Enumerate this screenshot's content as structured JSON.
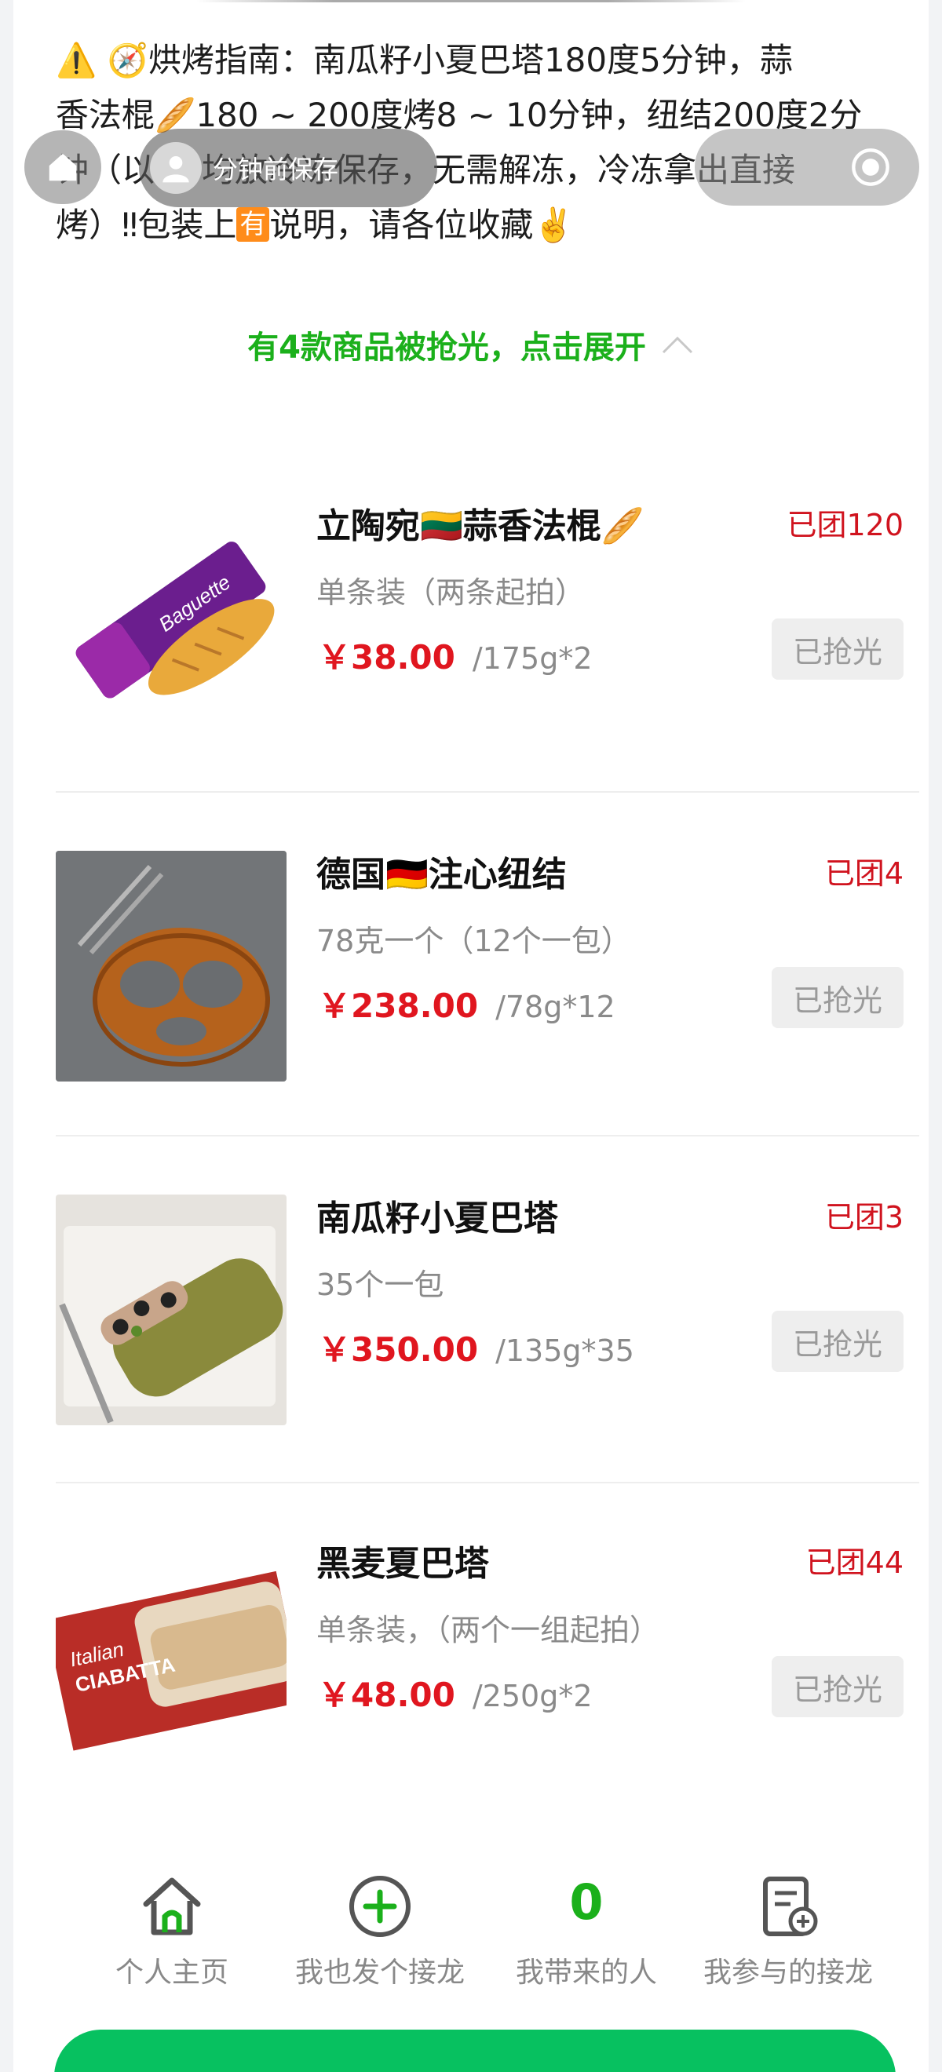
{
  "guide": {
    "line1_a": "烘烤指南：南瓜籽小夏巴塔180度5分钟，蒜",
    "line2_a": "香法棍",
    "line2_b": "180 ~ 200度烤8 ~ 10分钟，纽结200度2分",
    "line3_a": "钟（以",
    "line3_b": "均放冷冻保存，无需解冻，冷冻拿出直接",
    "line4_a": "烤）‼包装上",
    "line4_badge": "有",
    "line4_b": "说明，请各位收藏"
  },
  "overlay": {
    "pill_text": "分钟前保存"
  },
  "expand_text": "有4款商品被抢光，点击展开",
  "products": [
    {
      "name": "立陶宛🇱🇹蒜香法棍🥖",
      "sold": "已团120",
      "spec": "单条装（两条起拍）",
      "price": "￥38.00",
      "unit": "/175g*2",
      "status": "已抢光",
      "image_label": "Baguette"
    },
    {
      "name": "德国🇩🇪注心纽结",
      "sold": "已团4",
      "spec": "78克一个（12个一包）",
      "price": "￥238.00",
      "unit": "/78g*12",
      "status": "已抢光"
    },
    {
      "name": "南瓜籽小夏巴塔",
      "sold": "已团3",
      "spec": "35个一包",
      "price": "￥350.00",
      "unit": "/135g*35",
      "status": "已抢光"
    },
    {
      "name": "黑麦夏巴塔",
      "sold": "已团44",
      "spec": "单条装，（两个一组起拍）",
      "price": "￥48.00",
      "unit": "/250g*2",
      "status": "已抢光",
      "image_label_1": "Italian",
      "image_label_2": "CIABATTA"
    }
  ],
  "bottom_nav": {
    "home_label": "个人主页",
    "create_label": "我也发个接龙",
    "count_value": "0",
    "count_label": "我带来的人",
    "joined_label": "我参与的接龙"
  },
  "colors": {
    "accent_green": "#1bb01b",
    "price_red": "#e0161f",
    "sold_red": "#d0131e",
    "cta_green": "#07c160"
  }
}
